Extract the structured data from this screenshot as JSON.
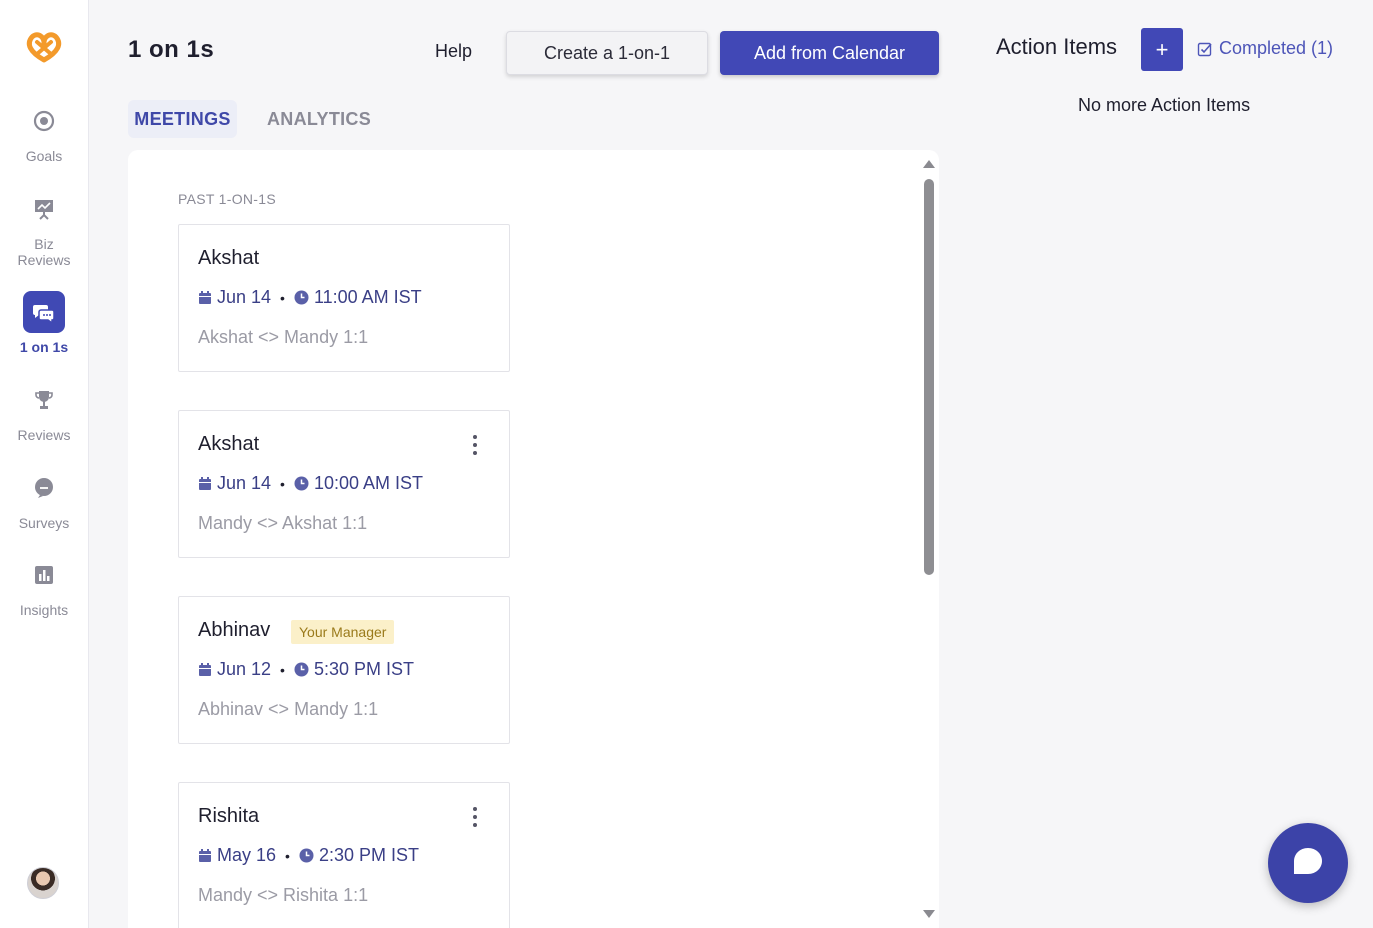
{
  "sidebar": {
    "logo": "pretzel-logo",
    "items": [
      {
        "label": "Goals",
        "icon": "target-icon"
      },
      {
        "label": "Biz Reviews",
        "icon": "presentation-board-icon"
      },
      {
        "label": "1 on 1s",
        "icon": "chat-bubbles-icon",
        "active": true
      },
      {
        "label": "Reviews",
        "icon": "trophy-icon"
      },
      {
        "label": "Surveys",
        "icon": "survey-bubble-icon"
      },
      {
        "label": "Insights",
        "icon": "bar-chart-icon"
      }
    ],
    "avatar": "user-avatar"
  },
  "header": {
    "title": "1 on 1s",
    "help": "Help",
    "create_button": "Create a 1-on-1",
    "calendar_button": "Add from Calendar"
  },
  "tabs": [
    {
      "label": "MEETINGS",
      "active": true
    },
    {
      "label": "ANALYTICS",
      "active": false
    }
  ],
  "meetings": {
    "section_label": "PAST 1-ON-1S",
    "cards": [
      {
        "name": "Akshat",
        "date": "Jun 14",
        "time": "11:00 AM IST",
        "title": "Akshat <> Mandy 1:1",
        "badge": "",
        "has_menu": false
      },
      {
        "name": "Akshat",
        "date": "Jun 14",
        "time": "10:00 AM IST",
        "title": "Mandy <> Akshat 1:1",
        "badge": "",
        "has_menu": true
      },
      {
        "name": "Abhinav",
        "date": "Jun 12",
        "time": "5:30 PM IST",
        "title": "Abhinav <> Mandy 1:1",
        "badge": "Your Manager",
        "has_menu": false
      },
      {
        "name": "Rishita",
        "date": "May 16",
        "time": "2:30 PM IST",
        "title": "Mandy <> Rishita 1:1",
        "badge": "",
        "has_menu": true
      }
    ]
  },
  "action_items": {
    "title": "Action Items",
    "add_label": "+",
    "completed_label": "Completed (1)",
    "empty_text": "No more Action Items"
  },
  "colors": {
    "primary": "#4148b6",
    "accent_text": "#3f48a8",
    "badge_bg": "#fbf0c9",
    "logo_orange": "#f39a2b"
  }
}
